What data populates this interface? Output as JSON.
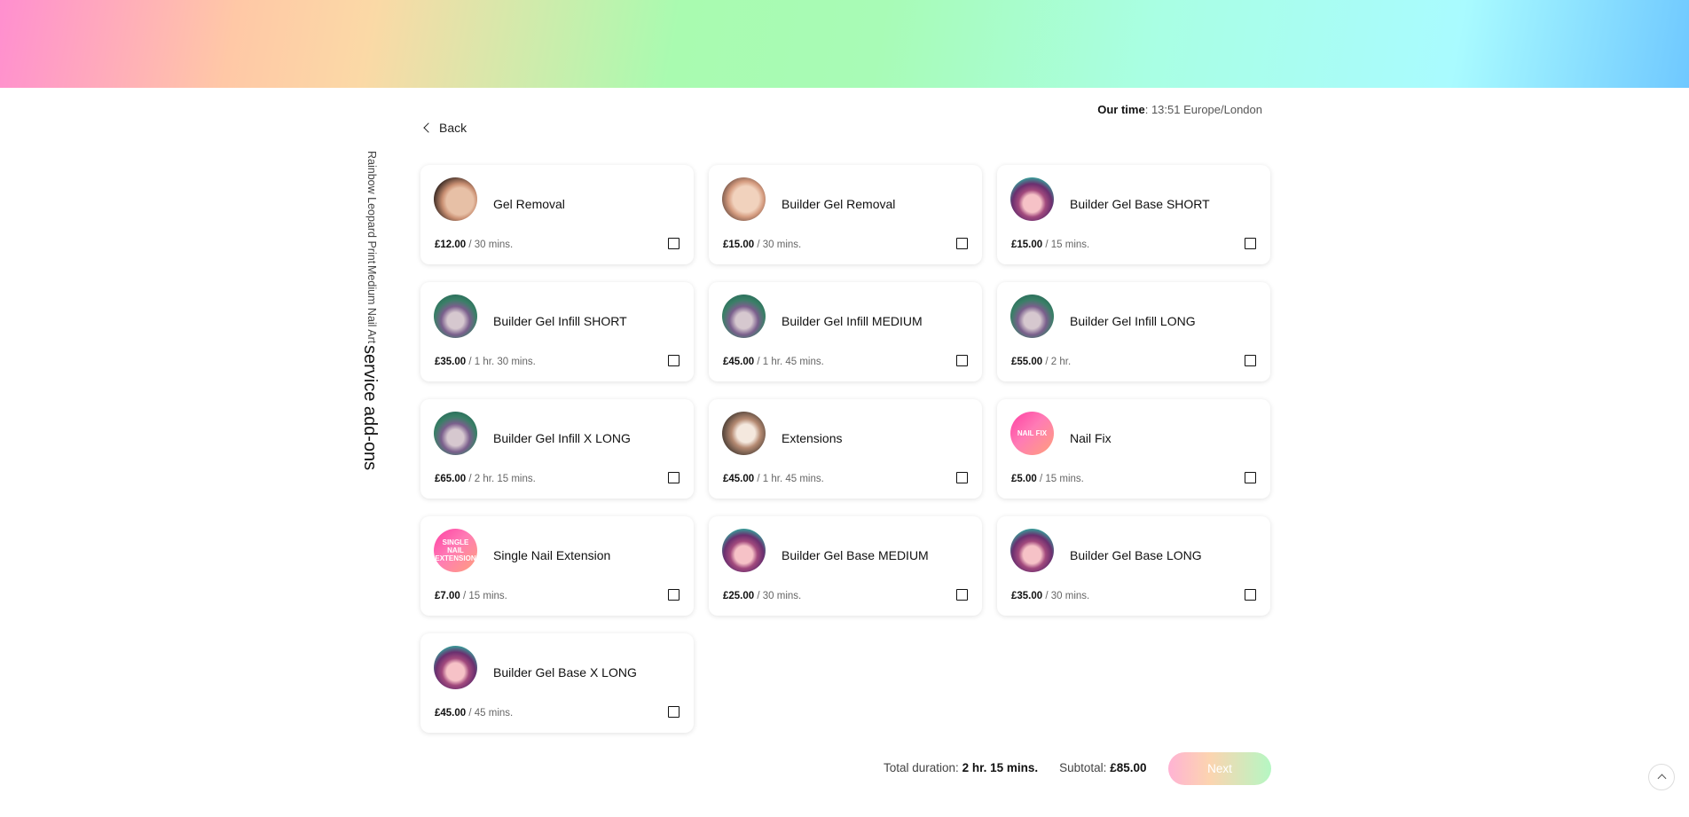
{
  "header": {
    "time_label": "Our time",
    "time_value": ": 13:51 Europe/London"
  },
  "nav": {
    "back_label": "Back"
  },
  "sidebar": {
    "title": "service add-ons",
    "lines": [
      "Medium Nail Art",
      "Rainbow Leopard Print"
    ]
  },
  "services": [
    {
      "name": "Gel Removal",
      "price": "£12.00",
      "duration": "30 mins.",
      "icon": "nails-nude",
      "badge": ""
    },
    {
      "name": "Builder Gel Removal",
      "price": "£15.00",
      "duration": "30 mins.",
      "icon": "nails-nude2",
      "badge": ""
    },
    {
      "name": "Builder Gel Base SHORT",
      "price": "£15.00",
      "duration": "15 mins.",
      "icon": "nails-purple",
      "badge": ""
    },
    {
      "name": "Builder Gel Infill SHORT",
      "price": "£35.00",
      "duration": "1 hr. 30 mins.",
      "icon": "nails-green",
      "badge": ""
    },
    {
      "name": "Builder Gel Infill MEDIUM",
      "price": "£45.00",
      "duration": "1 hr. 45 mins.",
      "icon": "nails-green",
      "badge": ""
    },
    {
      "name": "Builder Gel Infill LONG",
      "price": "£55.00",
      "duration": "2 hr.",
      "icon": "nails-green",
      "badge": ""
    },
    {
      "name": "Builder Gel Infill X LONG",
      "price": "£65.00",
      "duration": "2 hr. 15 mins.",
      "icon": "nails-green",
      "badge": ""
    },
    {
      "name": "Extensions",
      "price": "£45.00",
      "duration": "1 hr. 45 mins.",
      "icon": "nails-ext",
      "badge": ""
    },
    {
      "name": "Nail Fix",
      "price": "£5.00",
      "duration": "15 mins.",
      "icon": "pink-grad",
      "badge": "NAIL FIX"
    },
    {
      "name": "Single Nail Extension",
      "price": "£7.00",
      "duration": "15 mins.",
      "icon": "pink-grad",
      "badge": "SINGLE NAIL EXTENSION"
    },
    {
      "name": "Builder Gel Base MEDIUM",
      "price": "£25.00",
      "duration": "30 mins.",
      "icon": "nails-purple",
      "badge": ""
    },
    {
      "name": "Builder Gel Base LONG",
      "price": "£35.00",
      "duration": "30 mins.",
      "icon": "nails-purple",
      "badge": ""
    },
    {
      "name": "Builder Gel Base X LONG",
      "price": "£45.00",
      "duration": "45 mins.",
      "icon": "nails-purple",
      "badge": ""
    }
  ],
  "summary": {
    "duration_label": "Total duration:",
    "duration_value": "2 hr. 15 mins.",
    "subtotal_label": "Subtotal:",
    "subtotal_value": "£85.00"
  },
  "actions": {
    "next_label": "Next"
  },
  "colors": {
    "banner_start": "#ff8fcf",
    "banner_mid": "#a9fbb0",
    "banner_end": "#6fc8ff"
  }
}
